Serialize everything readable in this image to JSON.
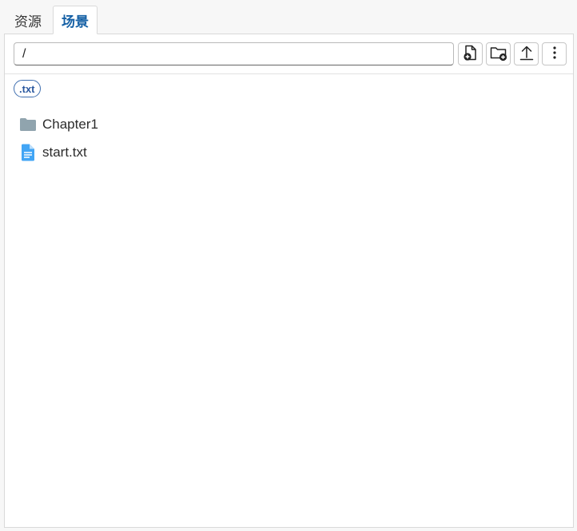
{
  "tabs": [
    {
      "label": "资源",
      "active": false
    },
    {
      "label": "场景",
      "active": true
    }
  ],
  "toolbar": {
    "path_value": "/",
    "buttons": [
      {
        "icon": "new-file-icon"
      },
      {
        "icon": "new-folder-icon"
      },
      {
        "icon": "upload-icon"
      },
      {
        "icon": "more-vertical-icon"
      }
    ]
  },
  "filter": {
    "label": ".txt"
  },
  "files": [
    {
      "name": "Chapter1",
      "type": "folder",
      "icon": "folder-icon",
      "color": "#90a4ae"
    },
    {
      "name": "start.txt",
      "type": "file",
      "icon": "text-file-icon",
      "color": "#42a5f5"
    }
  ],
  "colors": {
    "accent": "#1560a5",
    "chip_border": "#3f6fb0",
    "folder": "#90a4ae",
    "file": "#42a5f5"
  }
}
